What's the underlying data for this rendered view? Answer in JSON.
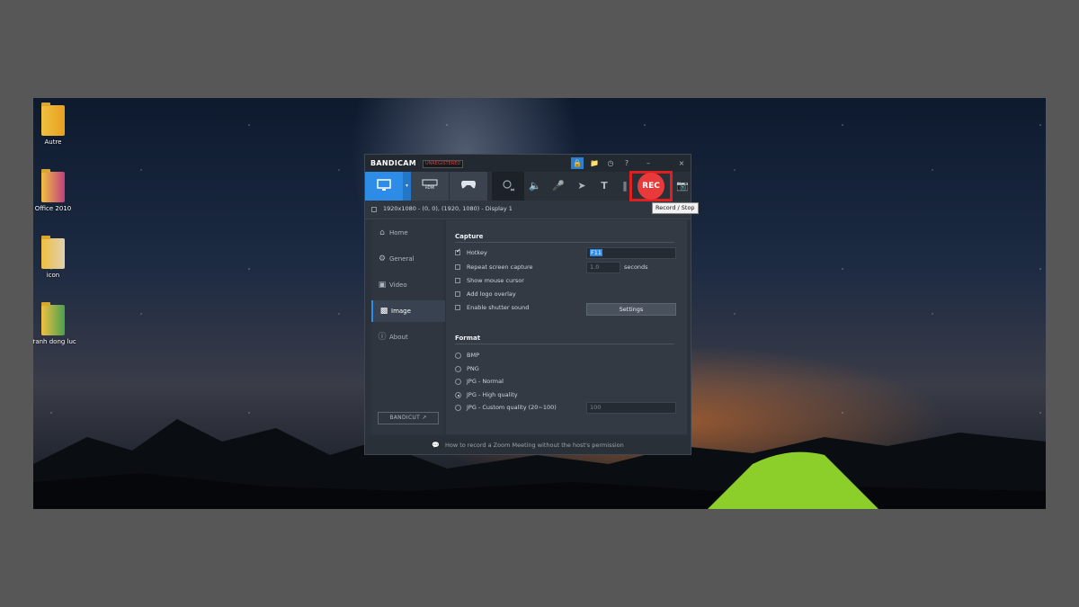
{
  "desktop": {
    "icons": [
      {
        "label": "Autre",
        "icon": "folder-icon"
      },
      {
        "label": "Office 2010",
        "icon": "folder-icon"
      },
      {
        "label": "icon",
        "icon": "folder-icon"
      },
      {
        "label": "Tranh dong luc",
        "icon": "folder-icon"
      }
    ]
  },
  "app": {
    "brand": "BANDICAM",
    "unregistered": "UNREGISTERED",
    "title_buttons": [
      "lock-icon",
      "folder-icon",
      "clock-icon",
      "help-icon",
      "minimize-icon",
      "close-icon"
    ],
    "hdmi_label": "HDMI",
    "rec_label": "REC",
    "rec_tooltip": "Record / Stop",
    "capture_area": "1920x1080 - (0, 0), (1920, 1080) - Display 1",
    "accent_color": "#2d8ce8",
    "rec_color": "#e83a3a"
  },
  "sidebar": {
    "items": [
      {
        "label": "Home",
        "icon": "home-icon"
      },
      {
        "label": "General",
        "icon": "gear-icon"
      },
      {
        "label": "Video",
        "icon": "video-icon"
      },
      {
        "label": "Image",
        "icon": "image-icon",
        "active": true
      },
      {
        "label": "About",
        "icon": "info-icon"
      }
    ],
    "bandicut": "BANDICUT"
  },
  "capture": {
    "title": "Capture",
    "hotkey": {
      "label": "Hotkey",
      "checked": true,
      "value": "F11"
    },
    "repeat": {
      "label": "Repeat screen capture",
      "checked": false,
      "value": "1.0",
      "unit": "seconds"
    },
    "cursor": {
      "label": "Show mouse cursor",
      "checked": false
    },
    "logo": {
      "label": "Add logo overlay",
      "checked": false
    },
    "shutter": {
      "label": "Enable shutter sound",
      "checked": false
    },
    "settings_button": "Settings"
  },
  "format": {
    "title": "Format",
    "options": [
      "BMP",
      "PNG",
      "JPG - Normal",
      "JPG - High quality",
      "JPG - Custom quality (20~100)"
    ],
    "selected": "JPG - High quality",
    "custom_quality_value": "100"
  },
  "footer": {
    "text": "How to record a Zoom Meeting without the host's permission"
  }
}
